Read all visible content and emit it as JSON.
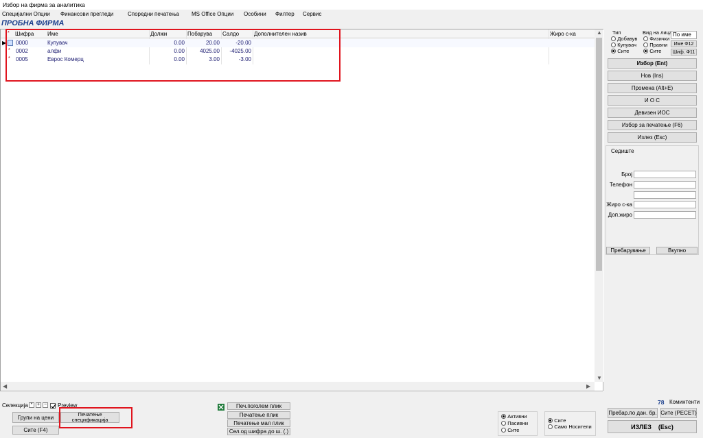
{
  "window": {
    "title": "Избор на фирма за аналитика"
  },
  "menu": [
    "Специјални Опции",
    "Финансови прегледи",
    "Споредни печатења",
    "MS Office Опции",
    "Особини",
    "Филтер",
    "Сервис"
  ],
  "firm_title": "ПРОБНА ФИРМА",
  "table": {
    "columns": [
      "Шифра",
      "Име",
      "Должи",
      "Побарува",
      "Салдо",
      "Дополнителен назив",
      "Жиро с-ка"
    ],
    "rows": [
      {
        "sifra": "0000",
        "ime": "Купувач",
        "dolzi": "0.00",
        "pobaruva": "20.00",
        "saldo": "-20.00"
      },
      {
        "sifra": "0002",
        "ime": "алфи",
        "dolzi": "0.00",
        "pobaruva": "4025.00",
        "saldo": "-4025.00"
      },
      {
        "sifra": "0005",
        "ime": "Еврос Комерц",
        "dolzi": "0.00",
        "pobaruva": "3.00",
        "saldo": "-3.00"
      }
    ]
  },
  "right_panel": {
    "tip_label": "Тип",
    "tip_options": [
      "Добавув",
      "Купувач",
      "Сите"
    ],
    "vid_label": "Вид на лица",
    "vid_options": [
      "Физички",
      "Правни",
      "Сите"
    ],
    "sort_value": "По име",
    "ime_button": "Име Ф12",
    "sif_button": "Шиф. Ф11",
    "buttons": [
      "Избор (Ent)",
      "Нов (Ins)",
      "Промена (Alt+E)",
      "И О С",
      "Девизен ИОС",
      "Избор за печатење (F6)",
      "Излез (Esc)"
    ],
    "sediste_label": "Седиште",
    "fields": [
      "Број",
      "Телефон",
      "",
      "Жиро с-ка",
      "Доп.жиро"
    ],
    "search_button": "Пребарување",
    "total_button": "Вкупно"
  },
  "bottom": {
    "selekcija_label": "Селекција",
    "preview_label": "Preview",
    "grupi_button": "Групи на цени",
    "site_button": "Сите (F4)",
    "pecatenje_spec_button_line1": "Печатење",
    "pecatenje_spec_button_line2": "спецификација",
    "print_buttons": [
      "Печ.поголем плик",
      "Печатење плик",
      "Печатење мал плик",
      "Сел.од шифра до ш. (.)"
    ],
    "status_options": [
      "Активни",
      "Пасивни",
      "Сите"
    ],
    "nositel_options": [
      "Сите",
      "Само Носители"
    ],
    "count": "78",
    "count_label": "Коминтенти",
    "prebar_button": "Пребар.по дан. бр.",
    "site_reset_button": "Сите (РЕСЕТ)",
    "exit_button": "ИЗЛЕЗ    (Esc)"
  },
  "colors": {
    "firm_title": "#1a3e8c",
    "cell_text": "#1a1a70",
    "highlight_border": "#e0141e"
  }
}
